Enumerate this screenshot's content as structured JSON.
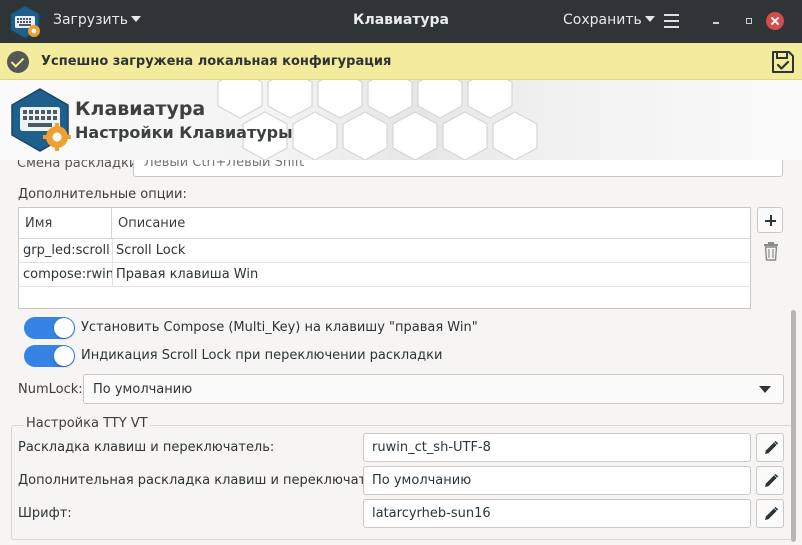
{
  "header": {
    "load_label": "Загрузить",
    "title": "Клавиатура",
    "save_label": "Сохранить"
  },
  "infobar": {
    "message": "Успешно загружена локальная конфигурация"
  },
  "banner": {
    "title": "Клавиатура",
    "subtitle": "Настройки Клавиатуры"
  },
  "layout_switch": {
    "label": "Смена раскладки:",
    "value": "Левый Ctrl+Левый Shift"
  },
  "options": {
    "label": "Дополнительные опции:",
    "columns": [
      "Имя",
      "Описание"
    ],
    "rows": [
      {
        "name": "grp_led:scroll",
        "description": "Scroll Lock"
      },
      {
        "name": "compose:rwin",
        "description": "Правая клавиша Win"
      }
    ]
  },
  "toggles": [
    {
      "label": "Установить Compose (Multi_Key) на клавишу \"правая Win\"",
      "on": true
    },
    {
      "label": "Индикация Scroll Lock при переключении раскладки",
      "on": true
    }
  ],
  "numlock": {
    "label": "NumLock:",
    "value": "По умолчанию"
  },
  "tty": {
    "title": "Настройка TTY VT",
    "fields": [
      {
        "label": "Раскладка клавиш и переключатель:",
        "value": "ruwin_ct_sh-UTF-8"
      },
      {
        "label": "Дополнительная раскладка клавиш и переключатель:",
        "value": "По умолчанию"
      },
      {
        "label": "Шрифт:",
        "value": "latarcyrheb-sun16"
      }
    ]
  },
  "colors": {
    "header_bg": "#2f3437",
    "infobar_bg": "#f2ec9c",
    "accent": "#3584e4",
    "close": "#d64b4b"
  },
  "icons": [
    "keyboard-gear-icon",
    "caret-down-icon",
    "hamburger-icon",
    "check-circle-icon",
    "save-check-icon",
    "plus-icon",
    "trash-icon",
    "pencil-icon"
  ]
}
